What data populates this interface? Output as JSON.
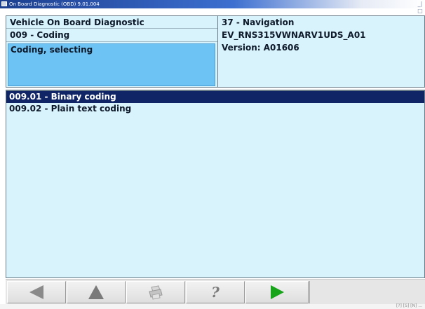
{
  "window": {
    "title": "On Board Diagnostic (OBD) 9.01.004",
    "controls": "_|□"
  },
  "header_left": {
    "line1": "Vehicle On Board Diagnostic",
    "line2": "009 - Coding",
    "line3": "Coding, selecting"
  },
  "header_right": {
    "line1": "37 - Navigation",
    "line2": "EV_RNS315VWNARV1UDS_A01",
    "line3": "Version: A01606"
  },
  "list": {
    "items": [
      {
        "label": "009.01 - Binary coding",
        "selected": true
      },
      {
        "label": "009.02 - Plain text coding",
        "selected": false
      }
    ]
  },
  "toolbar": {
    "buttons": [
      {
        "icon": "back-arrow-icon"
      },
      {
        "icon": "up-arrow-icon"
      },
      {
        "icon": "print-icon"
      },
      {
        "icon": "help-icon",
        "glyph": "?"
      },
      {
        "icon": "forward-arrow-icon"
      }
    ],
    "colors": {
      "active_arrow": "#17a31a",
      "inactive": "#808080"
    }
  },
  "status": {
    "text": "[?]  [S] [N] ..."
  }
}
